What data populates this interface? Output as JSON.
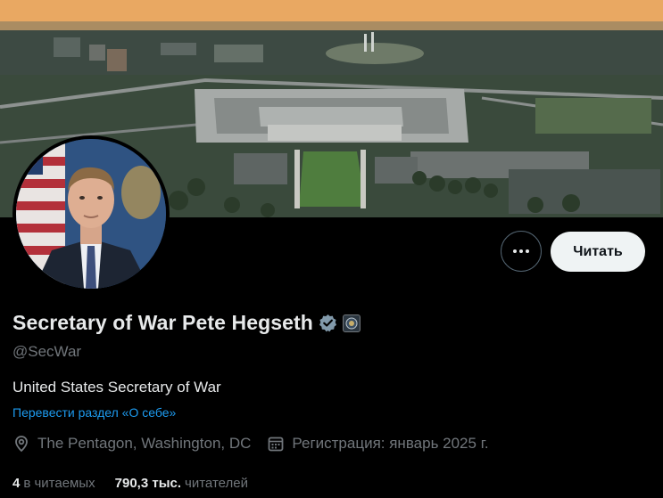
{
  "profile": {
    "display_name": "Secretary of War Pete Hegseth",
    "handle": "@SecWar",
    "bio": "United States Secretary of War",
    "translate_link": "Перевести раздел «О себе»",
    "location": "The Pentagon, Washington, DC",
    "joined": "Регистрация: январь 2025 г."
  },
  "actions": {
    "follow_label": "Читать",
    "more_icon": "more-horizontal-icon"
  },
  "stats": {
    "following_count": "4",
    "following_label": "в читаемых",
    "followers_count": "790,3 тыс.",
    "followers_label": "читателей"
  },
  "icons": {
    "verified": "verified-badge-icon",
    "affiliation": "affiliation-badge-icon",
    "location": "location-pin-icon",
    "calendar": "calendar-icon"
  },
  "colors": {
    "background": "#000000",
    "primary_text": "#e7e9ea",
    "secondary_text": "#71767b",
    "link": "#1d9bf0",
    "follow_button_bg": "#eff3f4"
  }
}
